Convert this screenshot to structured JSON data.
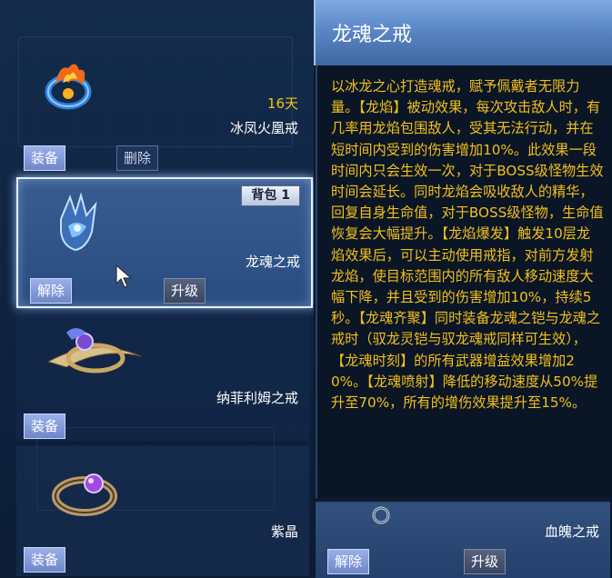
{
  "inventory": {
    "items": [
      {
        "name": "冰凤火凰戒",
        "days": "16天",
        "equip_label": "装备",
        "delete_label": "删除"
      },
      {
        "name": "龙魂之戒",
        "bag_label": "背包",
        "bag_number": "1",
        "unequip_label": "解除",
        "upgrade_label": "升级"
      },
      {
        "name": "纳菲利姆之戒",
        "equip_label": "装备"
      },
      {
        "name": "紫晶",
        "equip_label": "装备"
      }
    ]
  },
  "detail": {
    "title": "龙魂之戒",
    "description": "以冰龙之心打造魂戒，赋予佩戴者无限力量。【龙焰】被动效果，每次攻击敌人时，有几率用龙焰包围敌人，受其无法行动，并在短时间内受到的伤害增加10%。此效果一段时间内只会生效一次，对于BOSS级怪物生效时间会延长。同时龙焰会吸收敌人的精华，回复自身生命值，对于BOSS级怪物，生命值恢复会大幅提升。【龙焰爆发】触发10层龙焰效果后，可以主动使用戒指，对前方发射龙焰，使目标范围内的所有敌人移动速度大幅下降，并且受到的伤害增加10%，持续5秒。【龙魂齐聚】同时装备龙魂之铠与龙魂之戒时（驭龙灵铠与驭龙魂戒同样可生效），【龙魂时刻】的所有武器增益效果增加20%。【龙魂喷射】降低的移动速度从50%提升至70%，所有的增伤效果提升至15%。",
    "mini_item": {
      "name": "血魄之戒",
      "unequip_label": "解除",
      "upgrade_label": "升级"
    }
  },
  "colors": {
    "description_text": "#f2c01a",
    "days_text": "#f3c218",
    "selected_border": "#e4f0ff"
  },
  "icons": [
    "fire-phoenix-ring-icon",
    "dragon-soul-ring-icon",
    "nephilim-ring-icon",
    "amethyst-ring-icon",
    "blood-ring-icon",
    "mouse-cursor-icon"
  ]
}
